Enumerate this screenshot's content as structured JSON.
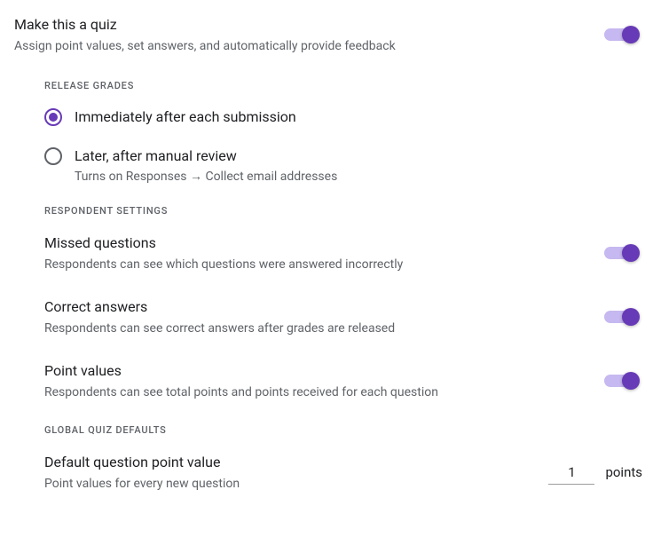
{
  "quiz_toggle": {
    "title": "Make this a quiz",
    "subtitle": "Assign point values, set answers, and automatically provide feedback"
  },
  "release_grades": {
    "header": "Release grades",
    "options": [
      {
        "label": "Immediately after each submission",
        "sub": ""
      },
      {
        "label": "Later, after manual review",
        "sub": "Turns on Responses → Collect email addresses"
      }
    ]
  },
  "respondent_settings": {
    "header": "Respondent settings",
    "missed": {
      "title": "Missed questions",
      "subtitle": "Respondents can see which questions were answered incorrectly"
    },
    "correct": {
      "title": "Correct answers",
      "subtitle": "Respondents can see correct answers after grades are released"
    },
    "points": {
      "title": "Point values",
      "subtitle": "Respondents can see total points and points received for each question"
    }
  },
  "global_defaults": {
    "header": "Global quiz defaults",
    "default_points": {
      "title": "Default question point value",
      "subtitle": "Point values for every new question",
      "value": "1",
      "unit": "points"
    }
  }
}
